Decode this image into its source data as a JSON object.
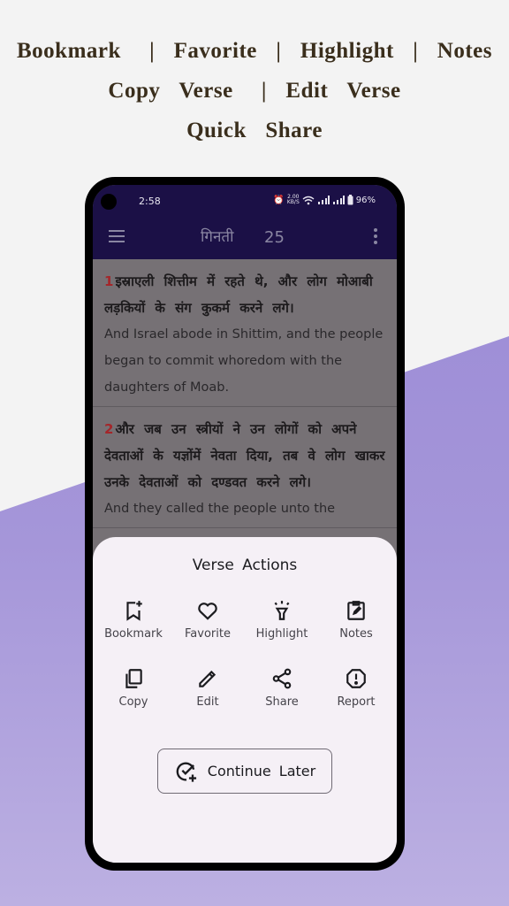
{
  "promo": {
    "line1": "Bookmark   |  Favorite  |  Highlight  |  Notes",
    "line2": "Copy  Verse   |  Edit  Verse",
    "line3": "Quick  Share"
  },
  "status_bar": {
    "time": "2:58",
    "speed_value": "2.00",
    "speed_unit": "KB/S",
    "battery": "96%",
    "icons": [
      "alarm-icon",
      "wifi-icon",
      "signal-icon",
      "signal-icon",
      "battery-icon"
    ]
  },
  "app_bar": {
    "book": "गिनती",
    "chapter": "25"
  },
  "verses": [
    {
      "number": "1",
      "hindi": "इस्राएली शित्तीम में रहते थे, और लोग मोआबी लड़कियों के संग कुकर्म करने लगे।",
      "english": "And Israel abode in Shittim, and the people began to commit whoredom with the daughters of Moab."
    },
    {
      "number": "2",
      "hindi": "और जब उन स्त्रीयों ने उन लोगों को अपने देवताओं के यज्ञोंमें नेवता दिया, तब वे लोग खाकर उनके देवताओं को दण्डवत करने लगे।",
      "english": "And they called the people unto the"
    }
  ],
  "sheet": {
    "title": "Verse  Actions",
    "actions": [
      {
        "label": "Bookmark",
        "icon": "bookmark-add-icon"
      },
      {
        "label": "Favorite",
        "icon": "heart-icon"
      },
      {
        "label": "Highlight",
        "icon": "highlight-icon"
      },
      {
        "label": "Notes",
        "icon": "notes-icon"
      },
      {
        "label": "Copy",
        "icon": "copy-icon"
      },
      {
        "label": "Edit",
        "icon": "pencil-icon"
      },
      {
        "label": "Share",
        "icon": "share-icon"
      },
      {
        "label": "Report",
        "icon": "report-icon"
      }
    ],
    "continue_label": "Continue  Later"
  },
  "colors": {
    "app_bar": "#1b1046",
    "verse_number": "#a4262a",
    "sheet_bg": "#f5f0f6",
    "accent_purple": "#9483d4"
  }
}
